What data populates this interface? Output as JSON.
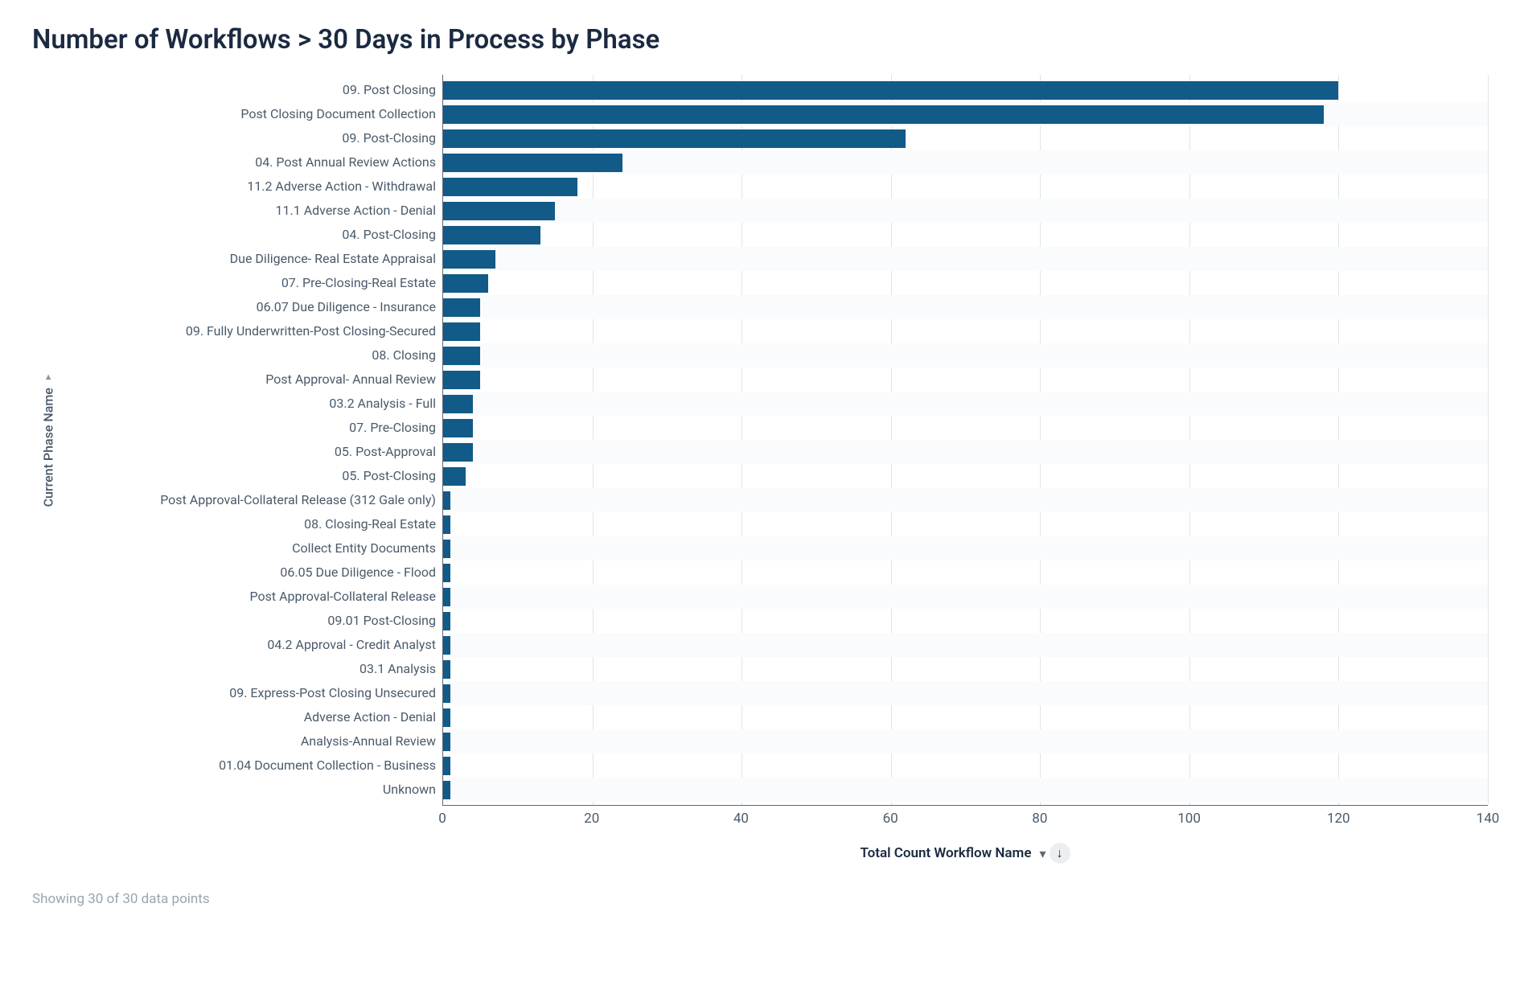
{
  "title": "Number of Workflows > 30 Days in Process by Phase",
  "yaxis": {
    "label": "Current Phase Name"
  },
  "xaxis": {
    "label": "Total Count Workflow Name",
    "ticks": [
      0,
      20,
      40,
      60,
      80,
      100,
      120,
      140
    ],
    "min": 0,
    "max": 140
  },
  "footer": "Showing 30 of 30 data points",
  "bar_color": "#125a88",
  "chart_data": {
    "type": "bar",
    "title": "Number of Workflows > 30 Days in Process by Phase",
    "xlabel": "Total Count Workflow Name",
    "ylabel": "Current Phase Name",
    "xlim": [
      0,
      140
    ],
    "categories": [
      "09. Post Closing",
      "Post Closing Document Collection",
      "09. Post-Closing",
      "04. Post Annual Review Actions",
      "11.2 Adverse Action - Withdrawal",
      "11.1 Adverse Action - Denial",
      "04. Post-Closing",
      "Due Diligence- Real Estate Appraisal",
      "07. Pre-Closing-Real Estate",
      "06.07 Due Diligence - Insurance",
      "09. Fully Underwritten-Post Closing-Secured",
      "08. Closing",
      "Post Approval- Annual Review",
      "03.2 Analysis - Full",
      "07. Pre-Closing",
      "05. Post-Approval",
      "05. Post-Closing",
      "Post Approval-Collateral Release (312 Gale only)",
      "08. Closing-Real Estate",
      "Collect Entity Documents",
      "06.05 Due Diligence - Flood",
      "Post Approval-Collateral Release",
      "09.01 Post-Closing",
      "04.2 Approval - Credit Analyst",
      "03.1 Analysis",
      "09. Express-Post Closing Unsecured",
      "Adverse Action - Denial",
      "Analysis-Annual Review",
      "01.04 Document Collection - Business",
      "Unknown"
    ],
    "values": [
      120,
      118,
      62,
      24,
      18,
      15,
      13,
      7,
      6,
      5,
      5,
      5,
      5,
      4,
      4,
      4,
      3,
      1,
      1,
      1,
      1,
      1,
      1,
      1,
      1,
      1,
      1,
      1,
      1,
      1
    ]
  }
}
